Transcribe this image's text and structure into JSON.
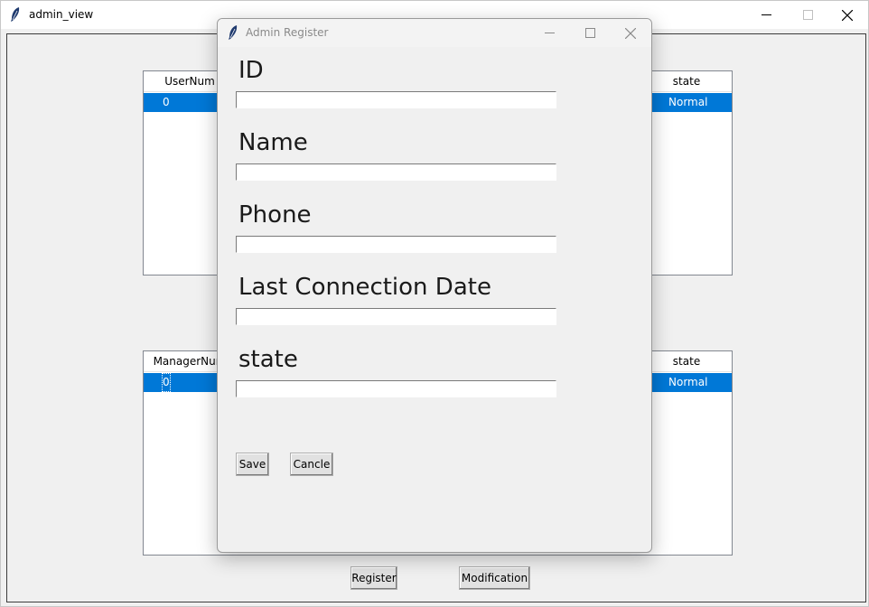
{
  "main_window": {
    "title": "admin_view"
  },
  "user_table": {
    "columns": [
      "UserNum",
      "state"
    ],
    "rows": [
      {
        "num": "0",
        "state": "Normal"
      }
    ]
  },
  "manager_table": {
    "columns": [
      "ManagerNum",
      "state"
    ],
    "rows": [
      {
        "num": "0",
        "state": "Normal"
      }
    ]
  },
  "buttons": {
    "register": "Register",
    "modification": "Modification"
  },
  "dialog": {
    "title": "Admin Register",
    "fields": [
      {
        "label": "ID",
        "value": ""
      },
      {
        "label": "Name",
        "value": ""
      },
      {
        "label": "Phone",
        "value": ""
      },
      {
        "label": "Last Connection Date",
        "value": ""
      },
      {
        "label": "state",
        "value": ""
      }
    ],
    "save_label": "Save",
    "cancel_label": "Cancle"
  },
  "colors": {
    "selection": "#0078d7",
    "window_bg": "#f0f0f0"
  },
  "icons": {
    "app": "feather-icon",
    "minimize": "minimize-icon",
    "maximize": "maximize-icon",
    "close": "close-icon"
  }
}
